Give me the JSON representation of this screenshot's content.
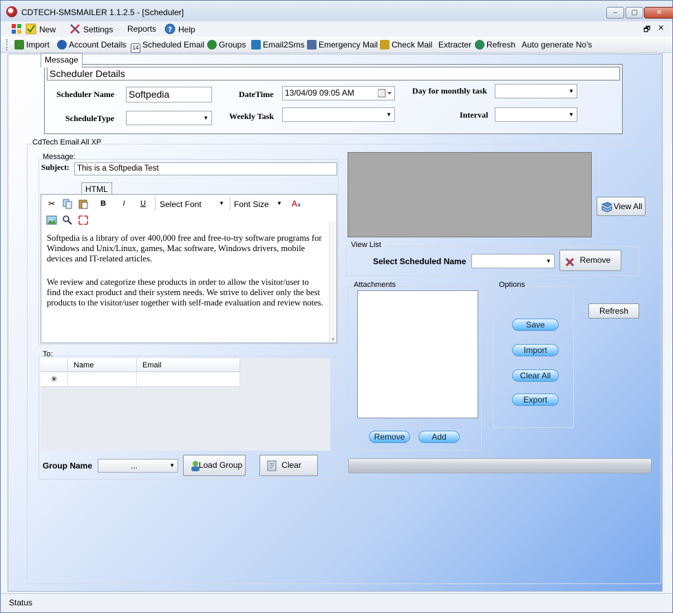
{
  "window": {
    "title": "CDTECH-SMSMAILER 1.1.2.5 - [Scheduler]",
    "min_glyph": "–",
    "max_glyph": "▢",
    "close_glyph": "✕"
  },
  "menubar": {
    "items": [
      {
        "label": "New",
        "icon": "new-icon"
      },
      {
        "label": "Settings",
        "icon": "settings-icon"
      },
      {
        "label": "Reports",
        "icon": ""
      },
      {
        "label": "Help",
        "icon": "help-icon"
      }
    ],
    "mdi_restore": "🗗",
    "mdi_close": "✕"
  },
  "toolbar": {
    "items": [
      {
        "label": "Import",
        "icon": "import-icon",
        "color": "#3a8a2a"
      },
      {
        "label": "Account Details",
        "icon": "users-icon",
        "color": "#2a5fb0"
      },
      {
        "label": "Scheduled Email",
        "icon": "calendar-icon",
        "color": "#4a6a8a"
      },
      {
        "label": "Groups",
        "icon": "groups-icon",
        "color": "#2f8a3a"
      },
      {
        "label": "Email2Sms",
        "icon": "email2sms-icon",
        "color": "#2a7ab8"
      },
      {
        "label": "Emergency Mail",
        "icon": "emergency-mail-icon",
        "color": "#4f6fa0"
      },
      {
        "label": "Check Mail",
        "icon": "check-mail-icon",
        "color": "#c9a020"
      },
      {
        "label": "Extracter",
        "icon": "",
        "color": ""
      },
      {
        "label": "Refresh",
        "icon": "refresh-icon",
        "color": "#2a8a5a"
      },
      {
        "label": "Auto generate No's",
        "icon": "",
        "color": ""
      }
    ]
  },
  "scheduler": {
    "header": "Scheduler Details",
    "name_label": "Scheduler Name",
    "name_value": "Softpedia",
    "datetime_label": "DateTime",
    "datetime_value": "13/04/09 09:05 AM",
    "monthly_label": "Day for monthly task",
    "monthly_value": "",
    "type_label": "ScheduleType",
    "type_value": "",
    "weekly_label": "Weekly Task",
    "weekly_value": "",
    "interval_label": "Interval",
    "interval_value": ""
  },
  "email_panel": {
    "title": "CdTech Email All XP",
    "message_group": "Message:",
    "subject_label": "Subject:",
    "subject_value": "This is a Softpedia Test",
    "tabs": [
      "Message",
      "HTML"
    ],
    "select_font": "Select Font",
    "font_size": "Font Size",
    "body_paragraphs": [
      "Softpedia is a library of over 400,000 free and free-to-try software programs for Windows and Unix/Linux, games, Mac software, Windows drivers, mobile devices and IT-related articles.",
      "We review and categorize these products in order to allow the visitor/user to find the exact product and their system needs. We strive to deliver only the best products to the visitor/user together with self-made evaluation and review notes."
    ],
    "to_group": "To:",
    "grid_columns": [
      "Name",
      "Email"
    ],
    "new_row_marker": "✳",
    "group_name_label": "Group Name",
    "group_name_value": "...",
    "load_group": "Load Group",
    "clear": "Clear"
  },
  "right_panel": {
    "view_all": "View All",
    "view_list_title": "View List",
    "select_scheduled_label": "Select Scheduled Name",
    "select_scheduled_value": "",
    "remove": "Remove",
    "attachments_title": "Attachments",
    "attach_remove": "Remove",
    "attach_add": "Add",
    "options_title": "Options",
    "options": [
      "Save",
      "Import",
      "Clear All",
      "Export"
    ],
    "refresh": "Refresh"
  },
  "status": {
    "text": "Status"
  }
}
